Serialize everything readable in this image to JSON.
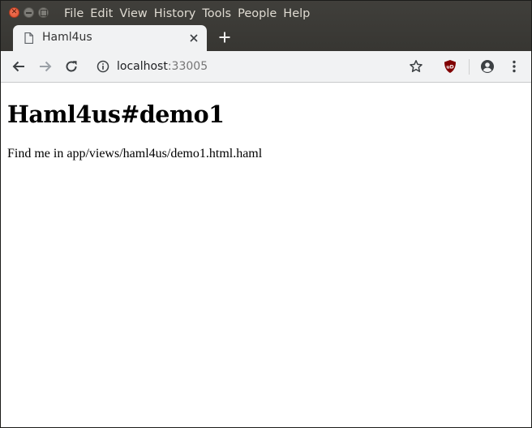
{
  "menu": [
    "File",
    "Edit",
    "View",
    "History",
    "Tools",
    "People",
    "Help"
  ],
  "tab": {
    "title": "Haml4us"
  },
  "address": {
    "host": "localhost",
    "port": ":33005"
  },
  "page": {
    "heading": "Haml4us#demo1",
    "paragraph": "Find me in app/views/haml4us/demo1.html.haml"
  },
  "icons": {
    "window_close": "close-icon",
    "window_minimize": "minimize-icon",
    "window_maximize": "maximize-icon",
    "tab_page": "document-icon",
    "tab_close": "close-icon",
    "new_tab": "plus-icon",
    "back": "arrow-left-icon",
    "forward": "arrow-right-icon",
    "reload": "reload-icon",
    "site_info": "info-icon",
    "bookmark": "star-icon",
    "ublock": "ublock-shield-icon",
    "profile": "account-icon",
    "menu": "kebab-menu-icon"
  },
  "colors": {
    "titlebar": "#3c3b37",
    "toolbar": "#f1f2f3",
    "close_button": "#e95a38",
    "ublock_badge": "#800000"
  }
}
